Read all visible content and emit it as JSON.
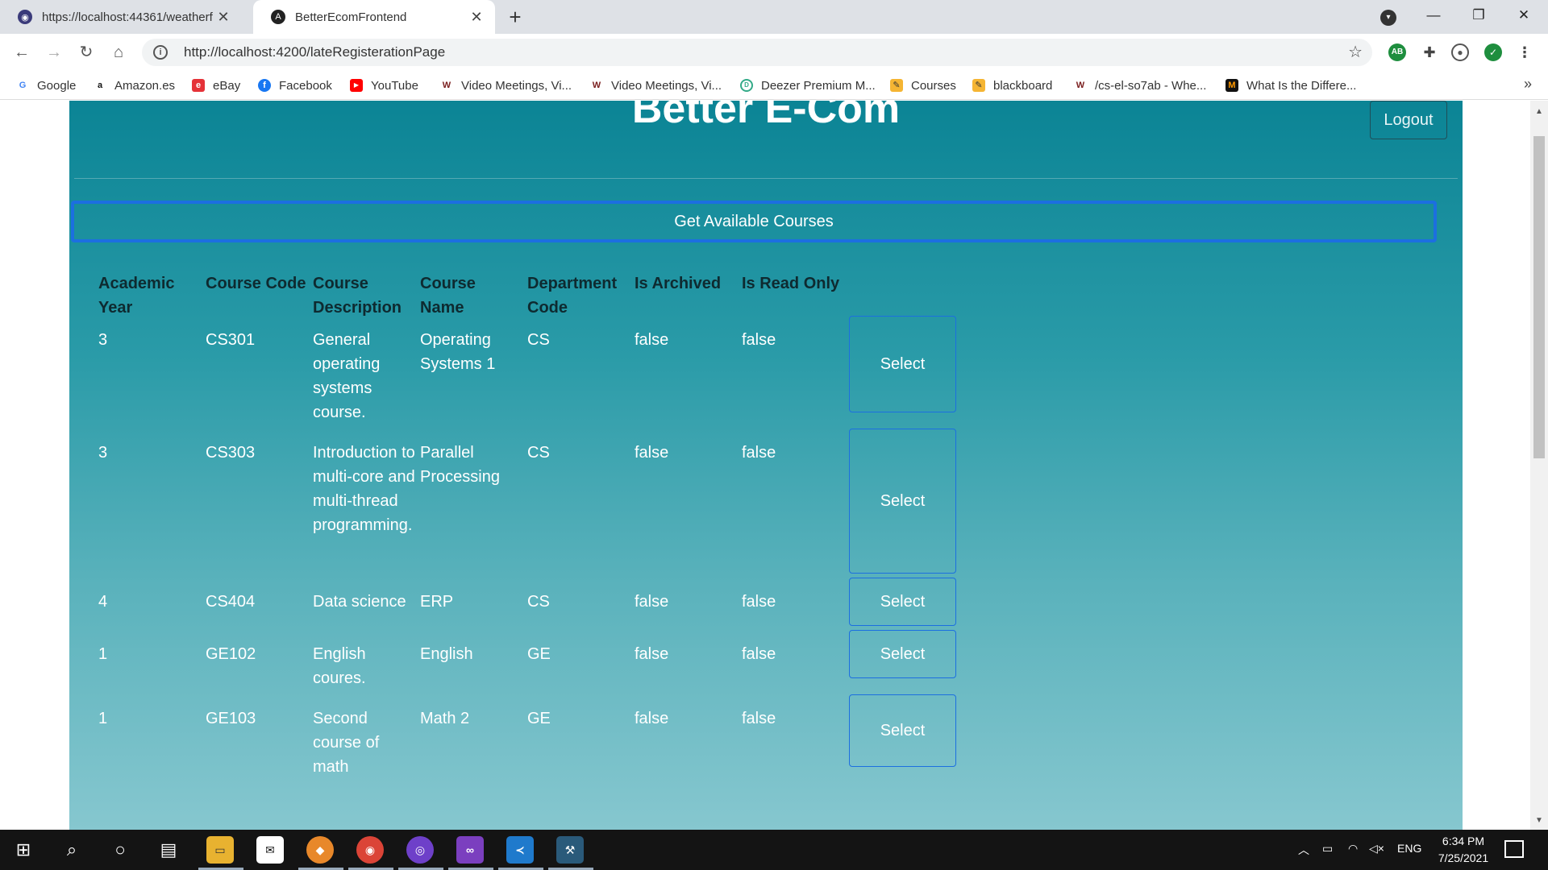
{
  "browser": {
    "tabs": [
      {
        "title": "https://localhost:44361/weatherf",
        "active": false
      },
      {
        "title": "BetterEcomFrontend",
        "active": true
      }
    ],
    "url": "http://localhost:4200/lateRegisterationPage",
    "extension_badge": "AB",
    "bookmarks": [
      {
        "label": "Google",
        "icon": "G"
      },
      {
        "label": "Amazon.es",
        "icon": "a"
      },
      {
        "label": "eBay",
        "icon": "e"
      },
      {
        "label": "Facebook",
        "icon": "f"
      },
      {
        "label": "YouTube",
        "icon": "▶"
      },
      {
        "label": "Video Meetings, Vi...",
        "icon": "W"
      },
      {
        "label": "Video Meetings, Vi...",
        "icon": "W"
      },
      {
        "label": "Deezer Premium M...",
        "icon": "D"
      },
      {
        "label": "Courses",
        "icon": "✎"
      },
      {
        "label": "blackboard",
        "icon": "✎"
      },
      {
        "label": "/cs-el-so7ab - Whe...",
        "icon": "W"
      },
      {
        "label": "What Is the Differe...",
        "icon": "M"
      }
    ]
  },
  "app": {
    "brand": "Better E-Com",
    "logout_label": "Logout",
    "get_courses_label": "Get Available Courses",
    "columns": {
      "academic_year": "Academic Year",
      "course_code": "Course Code",
      "course_description": "Course Description",
      "course_name": "Course Name",
      "department_code": "Department Code",
      "is_archived": "Is Archived",
      "is_read_only": "Is Read Only"
    },
    "select_label": "Select",
    "courses": [
      {
        "academic_year": "3",
        "course_code": "CS301",
        "description": "General operating systems course.",
        "name": "Operating Systems 1",
        "department": "CS",
        "is_archived": "false",
        "is_read_only": "false"
      },
      {
        "academic_year": "3",
        "course_code": "CS303",
        "description": "Introduction to multi-core and multi-thread programming.",
        "name": "Parallel Processing",
        "department": "CS",
        "is_archived": "false",
        "is_read_only": "false"
      },
      {
        "academic_year": "4",
        "course_code": "CS404",
        "description": "Data science",
        "name": "ERP",
        "department": "CS",
        "is_archived": "false",
        "is_read_only": "false"
      },
      {
        "academic_year": "1",
        "course_code": "GE102",
        "description": "English coures.",
        "name": "English",
        "department": "GE",
        "is_archived": "false",
        "is_read_only": "false"
      },
      {
        "academic_year": "1",
        "course_code": "GE103",
        "description": "Second course of math",
        "name": "Math 2",
        "department": "GE",
        "is_archived": "false",
        "is_read_only": "false"
      }
    ]
  },
  "taskbar": {
    "language": "ENG",
    "time": "6:34 PM",
    "date": "7/25/2021"
  }
}
